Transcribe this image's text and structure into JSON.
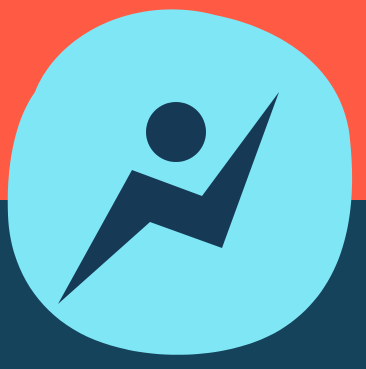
{
  "logo": {
    "icon": "running-person-bolt-logo",
    "colors": {
      "top_background": "#FF5A43",
      "bottom_background": "#16435C",
      "blob": "#7EE6F5",
      "figure": "#163A55"
    }
  }
}
